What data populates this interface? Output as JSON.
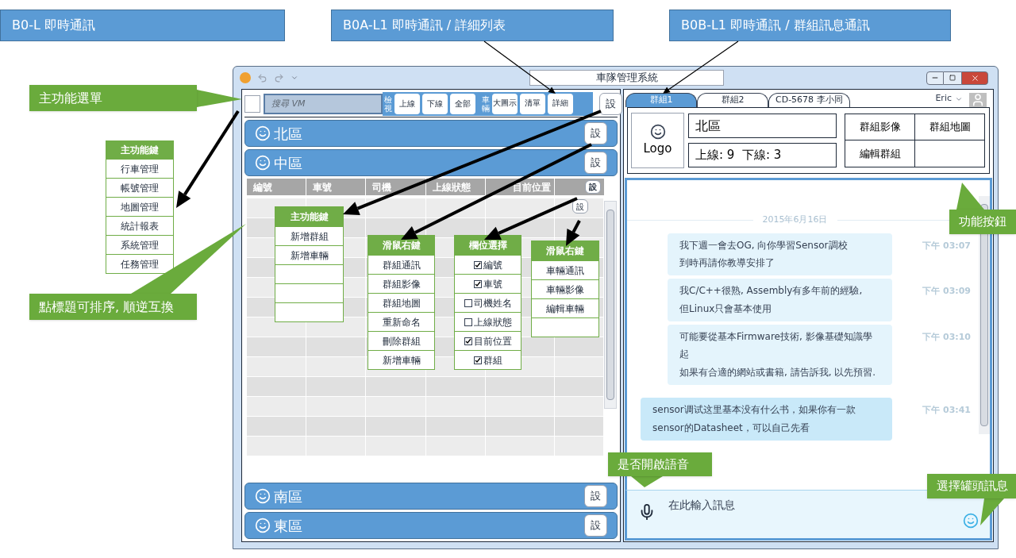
{
  "slide_titles": [
    "B0-L 即時通訊",
    "B0A-L1 即時通訊 / 詳細列表",
    "B0B-L1 即時通訊 / 群組訊息通訊"
  ],
  "callouts": [
    "主功能選單",
    "點標題可排序, 順逆互換",
    "功能按鈕",
    "是否開啟語音",
    "選擇罐頭訊息"
  ],
  "main_menu": {
    "title": "主功能鍵",
    "items": [
      "行車管理",
      "帳號管理",
      "地圖管理",
      "統計報表",
      "系統管理",
      "任務管理"
    ]
  },
  "window": {
    "title": "車隊管理系統"
  },
  "left_panel": {
    "select_all": {
      "checked": false
    },
    "search": {
      "placeholder": "搜尋 VM"
    },
    "view_label": "檢視",
    "view_buttons": [
      "上線",
      "下線",
      "全部"
    ],
    "vehicle_label": "車輛",
    "layout_buttons": [
      "大圖示",
      "清單",
      "詳細"
    ],
    "settings_button": "設",
    "groups_top": [
      {
        "name": "北區",
        "button": "設"
      },
      {
        "name": "中區",
        "button": "設"
      }
    ],
    "table": {
      "columns": [
        "編號",
        "車號",
        "司機",
        "上線狀態",
        "目前位置"
      ],
      "header_button": "設",
      "row_button": "設"
    },
    "popup_menus": [
      {
        "kind": "plain",
        "title": "主功能鍵",
        "items": [
          {
            "label": "新增群組"
          },
          {
            "label": "新增車輛"
          }
        ]
      },
      {
        "kind": "plain",
        "title": "滑鼠右鍵",
        "items": [
          {
            "label": "群組通訊"
          },
          {
            "label": "群組影像"
          },
          {
            "label": "群組地圖"
          },
          {
            "label": "重新命名"
          },
          {
            "label": "刪除群組"
          },
          {
            "label": "新增車輛"
          }
        ]
      },
      {
        "kind": "checklist",
        "title": "欄位選擇",
        "items": [
          {
            "label": "編號",
            "checked": true
          },
          {
            "label": "車號",
            "checked": true
          },
          {
            "label": "司機姓名",
            "checked": false
          },
          {
            "label": "上線狀態",
            "checked": false
          },
          {
            "label": "目前位置",
            "checked": true
          },
          {
            "label": "群組",
            "checked": true
          }
        ]
      },
      {
        "kind": "plain",
        "title": "滑鼠右鍵",
        "items": [
          {
            "label": "車輛通訊"
          },
          {
            "label": "車輛影像"
          },
          {
            "label": "編輯車輛"
          }
        ]
      }
    ],
    "groups_bottom": [
      {
        "name": "南區",
        "button": "設"
      },
      {
        "name": "東區",
        "button": "設"
      }
    ]
  },
  "right_panel": {
    "tabs": [
      {
        "label": "群組1",
        "selected": true
      },
      {
        "label": "群組2",
        "selected": false
      },
      {
        "label": "CD-5678 李小同",
        "selected": false
      }
    ],
    "user": "Eric",
    "group_card": {
      "logo": "Logo",
      "name": "北區",
      "status": "上線: 9  下線: 3",
      "buttons": [
        "群組影像",
        "群組地圖",
        "編輯群組"
      ]
    },
    "chat": {
      "date": "2015年6月16日",
      "messages": [
        {
          "kind": "sent",
          "paragraphs": [
            "我下週一會去OG, 向你學習Sensor調校",
            "到時再請你教導安排了"
          ],
          "time": "下午 03:07"
        },
        {
          "kind": "sent",
          "paragraphs": [
            "我C/C++很熟, Assembly有多年前的經驗,",
            "但Linux只會基本使用"
          ],
          "time": "下午 03:09"
        },
        {
          "kind": "sent",
          "paragraphs": [
            "可能要從基本Firmware技術, 影像基礎知識學起",
            "如果有合適的網站或書籍, 請告訴我, 以先預習."
          ],
          "time": "下午 03:10"
        },
        {
          "kind": "received",
          "paragraphs": [
            "sensor调试这里基本没有什么书，如果你有一款sensor的Datasheet，可以自己先看"
          ],
          "time": "下午 03:41"
        }
      ]
    },
    "input": {
      "placeholder": "在此輸入訊息"
    }
  }
}
